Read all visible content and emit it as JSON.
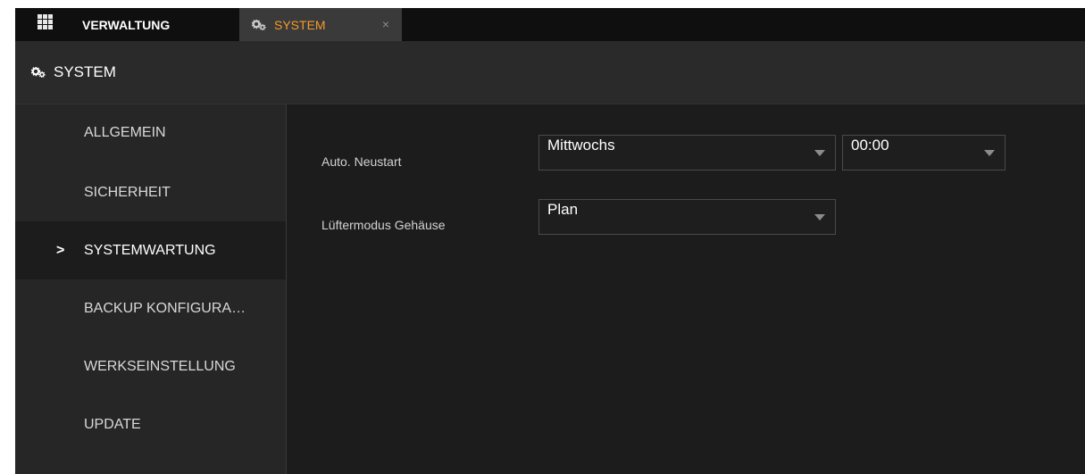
{
  "tabs": {
    "menu_icon": "grid-icon",
    "manage_label": "VERWALTUNG",
    "system_label": "SYSTEM",
    "close_label": "×",
    "active_color": "#f39a2b"
  },
  "header": {
    "icon": "gears-icon",
    "title": "SYSTEM"
  },
  "sidebar": {
    "items": [
      {
        "label": "ALLGEMEIN",
        "active": false
      },
      {
        "label": "SICHERHEIT",
        "active": false
      },
      {
        "label": "SYSTEMWARTUNG",
        "active": true
      },
      {
        "label": "BACKUP KONFIGURA…",
        "active": false
      },
      {
        "label": "WERKSEINSTELLUNG",
        "active": false
      },
      {
        "label": "UPDATE",
        "active": false
      }
    ],
    "active_marker": ">"
  },
  "form": {
    "auto_restart": {
      "label": "Auto. Neustart",
      "day_value": "Mittwochs",
      "time_value": "00:00"
    },
    "fan_mode": {
      "label": "Lüftermodus Gehäuse",
      "value": "Plan"
    }
  }
}
